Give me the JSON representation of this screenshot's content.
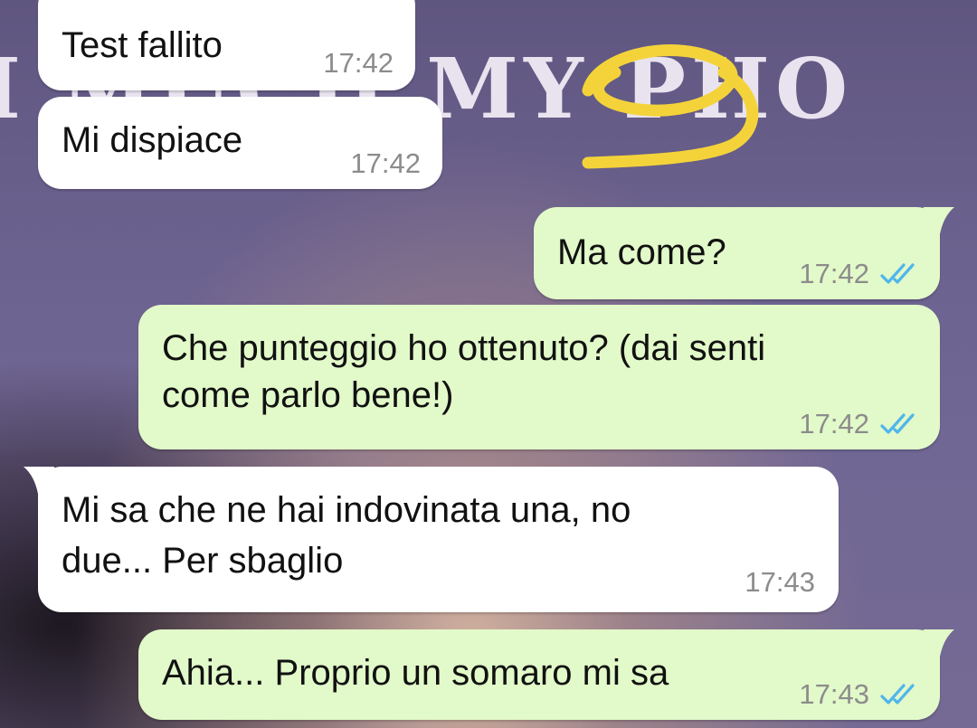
{
  "background": {
    "wallpaper_text": "I  MUCH MY PHO"
  },
  "messages": [
    {
      "direction": "incoming",
      "text": "Test fallito",
      "time": "17:42"
    },
    {
      "direction": "incoming",
      "text": "Mi dispiace",
      "time": "17:42"
    },
    {
      "direction": "outgoing",
      "text": "Ma come?",
      "time": "17:42",
      "status": "read"
    },
    {
      "direction": "outgoing",
      "text_line1": "Che punteggio ho ottenuto? (dai senti",
      "text_line2": "come parlo bene!)",
      "time": "17:42",
      "status": "read"
    },
    {
      "direction": "incoming",
      "text_line1": "Mi sa che ne hai indovinata una, no",
      "text_line2": "due... Per sbaglio",
      "time": "17:43"
    },
    {
      "direction": "outgoing",
      "text": "Ahia... Proprio un somaro mi sa",
      "time": "17:43",
      "status": "read"
    }
  ],
  "colors": {
    "incoming_bubble": "#ffffff",
    "outgoing_bubble": "#e2f9c9",
    "read_tick": "#4fb6ec",
    "annotation": "#f4d33a"
  },
  "icons": {
    "read_status": "double-check-icon"
  }
}
